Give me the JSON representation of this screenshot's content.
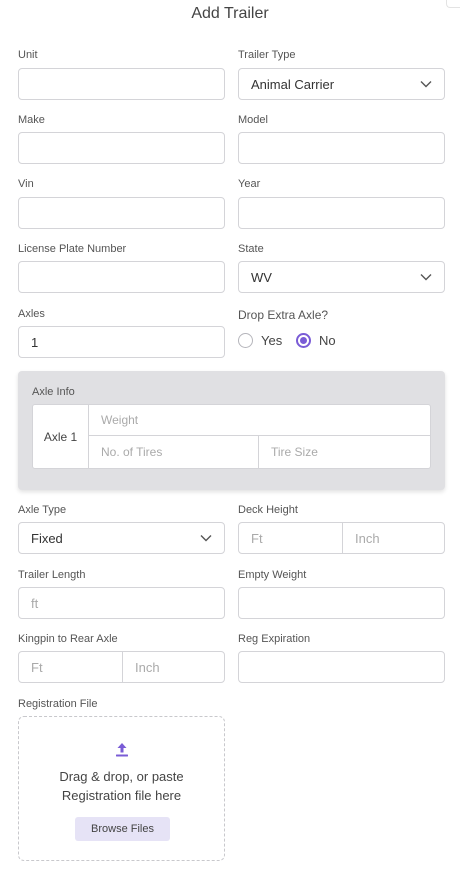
{
  "title": "Add Trailer",
  "fields": {
    "unit": {
      "label": "Unit",
      "value": ""
    },
    "trailer_type": {
      "label": "Trailer Type",
      "value": "Animal Carrier"
    },
    "make": {
      "label": "Make",
      "value": ""
    },
    "model": {
      "label": "Model",
      "value": ""
    },
    "vin": {
      "label": "Vin",
      "value": ""
    },
    "year": {
      "label": "Year",
      "value": ""
    },
    "license_plate": {
      "label": "License Plate Number",
      "value": ""
    },
    "state": {
      "label": "State",
      "value": "WV"
    },
    "axles": {
      "label": "Axles",
      "value": "1"
    },
    "drop_extra_axle": {
      "label": "Drop Extra Axle?",
      "options": [
        "Yes",
        "No"
      ],
      "selected": "No"
    },
    "axle_type": {
      "label": "Axle Type",
      "value": "Fixed"
    },
    "deck_height": {
      "label": "Deck Height",
      "ft_placeholder": "Ft",
      "inch_placeholder": "Inch"
    },
    "trailer_length": {
      "label": "Trailer Length",
      "placeholder": "ft"
    },
    "empty_weight": {
      "label": "Empty Weight",
      "value": ""
    },
    "kingpin": {
      "label": "Kingpin to Rear Axle",
      "ft_placeholder": "Ft",
      "inch_placeholder": "Inch"
    },
    "reg_expiration": {
      "label": "Reg Expiration",
      "value": ""
    }
  },
  "axle_info": {
    "label": "Axle Info",
    "axles": [
      {
        "name": "Axle 1",
        "weight_placeholder": "Weight",
        "tires_placeholder": "No. of Tires",
        "tire_size_placeholder": "Tire Size"
      }
    ]
  },
  "registration_file": {
    "label": "Registration File",
    "line1": "Drag & drop, or paste",
    "line2": "Registration file here",
    "button": "Browse Files"
  },
  "colors": {
    "accent": "#7a5cd6",
    "border": "#d4d4d8",
    "panel": "#e0e0e3"
  }
}
